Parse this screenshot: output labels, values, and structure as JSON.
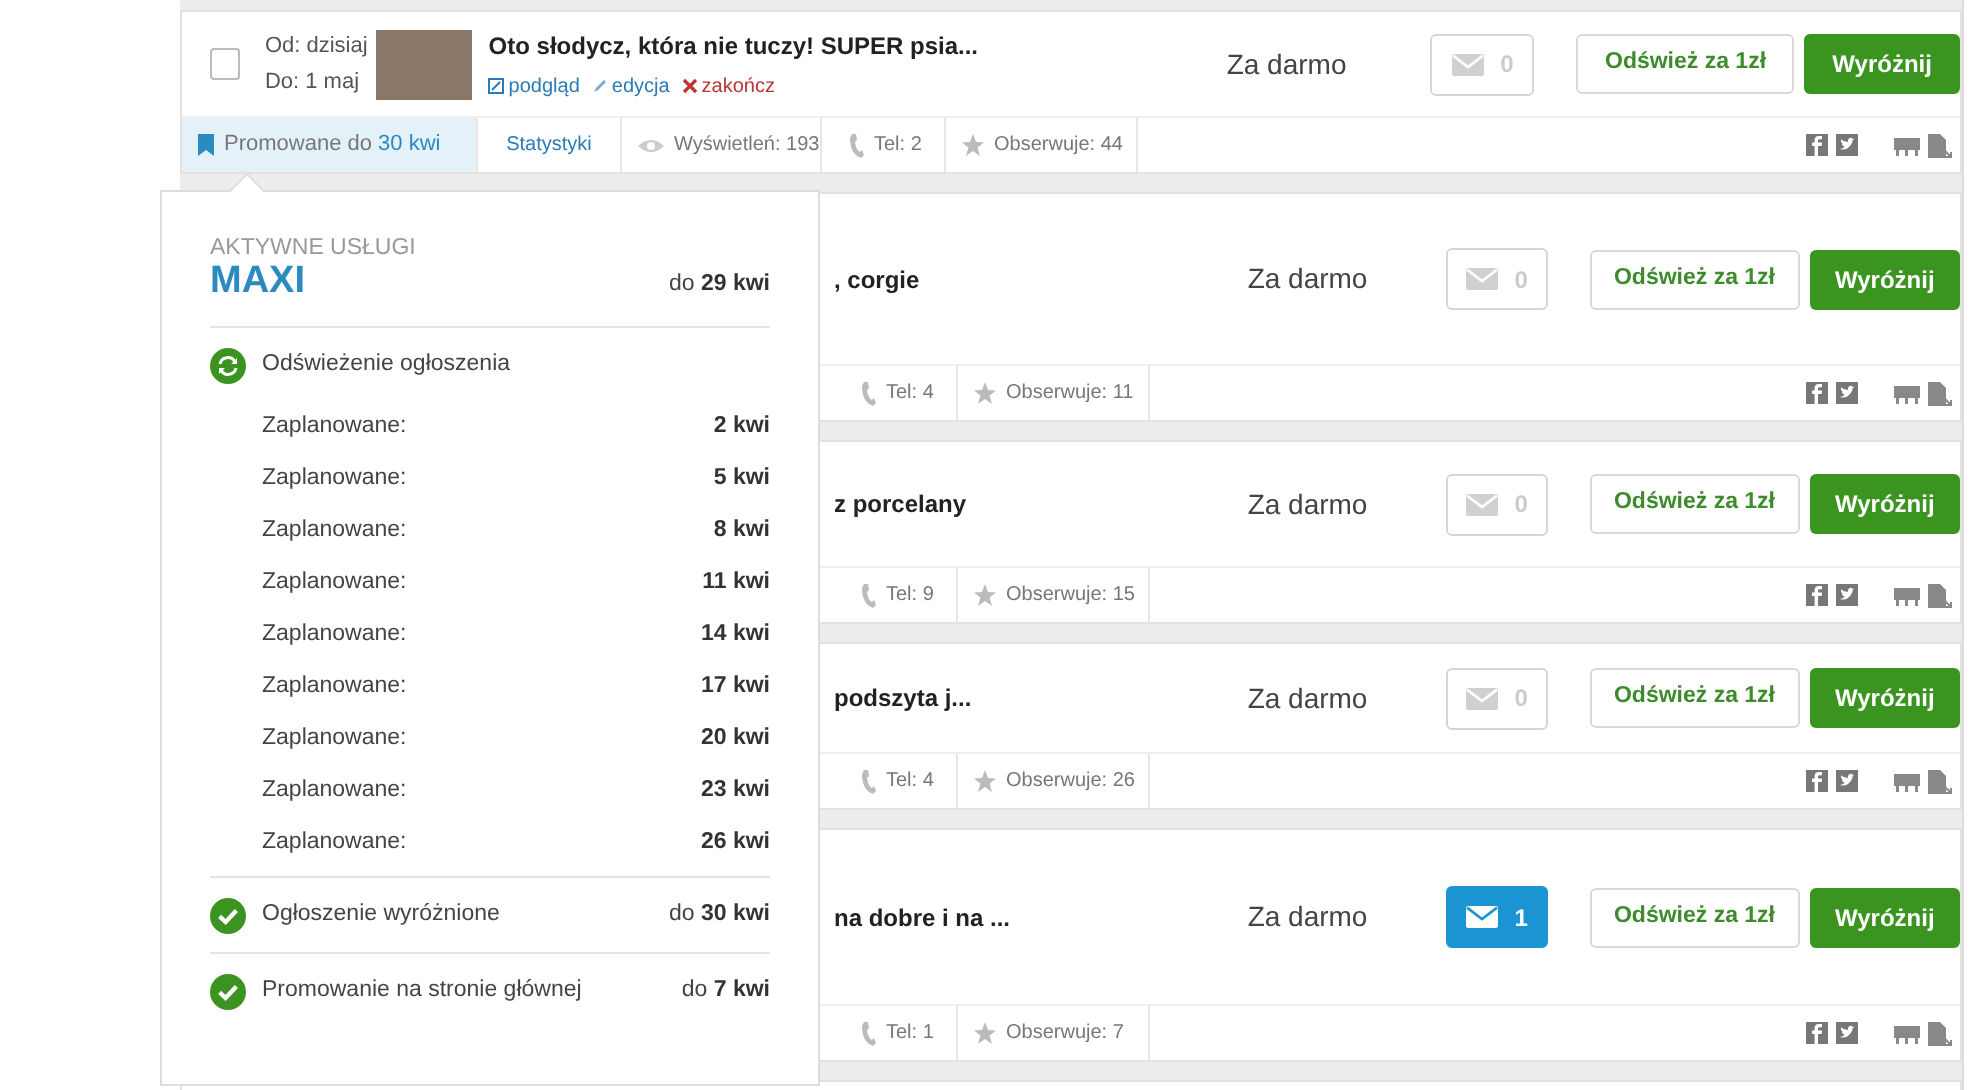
{
  "listings": [
    {
      "kind": "full",
      "selected": false,
      "date_from": "Od: dzisiaj",
      "date_to": "Do: 1 maj",
      "title": "Oto słodycz, która nie tuczy! SUPER psia...",
      "actions": [
        {
          "kind": "preview",
          "label": "podgląd"
        },
        {
          "kind": "edit",
          "label": "edycja"
        },
        {
          "kind": "end",
          "label": "zakończ"
        }
      ],
      "price": "Za darmo",
      "messages": {
        "count": "0",
        "unread": false
      },
      "refresh_button": "Odśwież za 1zł",
      "highlight_button": "Wyróżnij",
      "promo": {
        "text": "Promowane do",
        "date": "30 kwi",
        "expanded": true
      },
      "stats_link": "Statystyki",
      "views": "Wyświetleń: 193",
      "phone": "Tel: 2",
      "watchers": "Obserwuje: 44"
    },
    {
      "kind": "covered",
      "title": ", corgie",
      "price": "Za darmo",
      "messages": {
        "count": "0",
        "unread": false
      },
      "refresh_button": "Odśwież za 1zł",
      "highlight_button": "Wyróżnij",
      "phone": "Tel: 4",
      "watchers": "Obserwuje: 11"
    },
    {
      "kind": "covered",
      "title": "z porcelany",
      "price": "Za darmo",
      "messages": {
        "count": "0",
        "unread": false
      },
      "refresh_button": "Odśwież za 1zł",
      "highlight_button": "Wyróżnij",
      "phone": "Tel: 9",
      "watchers": "Obserwuje: 15"
    },
    {
      "kind": "covered",
      "title": "podszyta j...",
      "price": "Za darmo",
      "messages": {
        "count": "0",
        "unread": false
      },
      "refresh_button": "Odśwież za 1zł",
      "highlight_button": "Wyróżnij",
      "phone": "Tel: 4",
      "watchers": "Obserwuje: 26"
    },
    {
      "kind": "covered",
      "title": "na dobre i na ...",
      "price": "Za darmo",
      "messages": {
        "count": "1",
        "unread": true
      },
      "refresh_button": "Odśwież za 1zł",
      "highlight_button": "Wyróżnij",
      "phone": "Tel: 1",
      "watchers": "Obserwuje: 7"
    }
  ],
  "popup": {
    "heading": "AKTYWNE USŁUGI",
    "package": "MAXI",
    "package_until": "do **29 kwi**",
    "services": [
      {
        "kind": "refresh",
        "label": "Odświeżenie ogłoszenia",
        "schedule": [
          {
            "label": "Zaplanowane:",
            "date": "2 kwi"
          },
          {
            "label": "Zaplanowane:",
            "date": "5 kwi"
          },
          {
            "label": "Zaplanowane:",
            "date": "8 kwi"
          },
          {
            "label": "Zaplanowane:",
            "date": "11 kwi"
          },
          {
            "label": "Zaplanowane:",
            "date": "14 kwi"
          },
          {
            "label": "Zaplanowane:",
            "date": "17 kwi"
          },
          {
            "label": "Zaplanowane:",
            "date": "20 kwi"
          },
          {
            "label": "Zaplanowane:",
            "date": "23 kwi"
          },
          {
            "label": "Zaplanowane:",
            "date": "26 kwi"
          }
        ]
      },
      {
        "kind": "done",
        "label": "Ogłoszenie wyróżnione",
        "until": "do **30 kwi**"
      },
      {
        "kind": "done",
        "label": "Promowanie na stronie głównej",
        "until": "do **7 kwi**"
      }
    ]
  }
}
